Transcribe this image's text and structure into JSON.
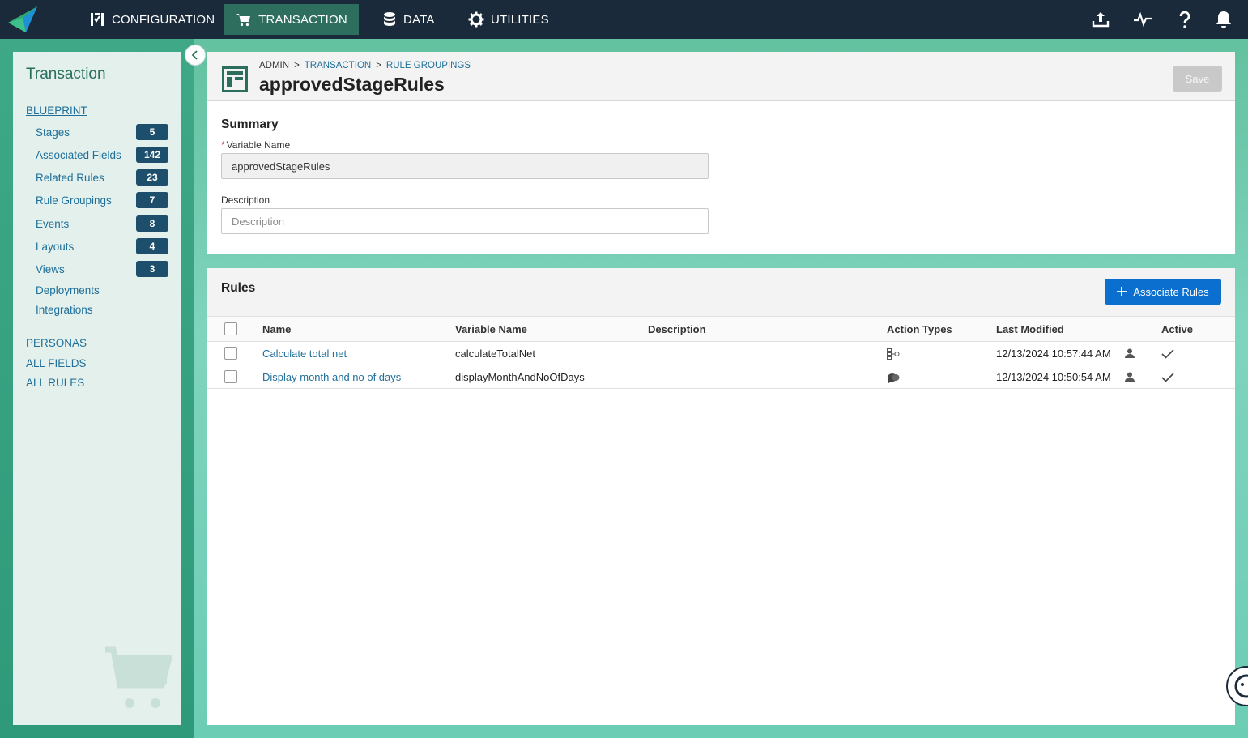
{
  "nav": {
    "items": [
      {
        "label": "CONFIGURATION",
        "icon": "configuration-icon"
      },
      {
        "label": "TRANSACTION",
        "icon": "cart-icon",
        "active": true
      },
      {
        "label": "DATA",
        "icon": "database-icon"
      },
      {
        "label": "UTILITIES",
        "icon": "gear-icon"
      }
    ],
    "right_icons": [
      "upload-icon",
      "activity-icon",
      "help-icon",
      "bell-icon"
    ]
  },
  "sidebar": {
    "title": "Transaction",
    "blueprint": "BLUEPRINT",
    "items": [
      {
        "label": "Stages",
        "count": "5"
      },
      {
        "label": "Associated Fields",
        "count": "142"
      },
      {
        "label": "Related Rules",
        "count": "23"
      },
      {
        "label": "Rule Groupings",
        "count": "7"
      },
      {
        "label": "Events",
        "count": "8"
      },
      {
        "label": "Layouts",
        "count": "4"
      },
      {
        "label": "Views",
        "count": "3"
      },
      {
        "label": "Deployments"
      },
      {
        "label": "Integrations"
      }
    ],
    "links": [
      "PERSONAS",
      "ALL FIELDS",
      "ALL RULES"
    ]
  },
  "header": {
    "breadcrumb": [
      "ADMIN",
      "TRANSACTION",
      "RULE GROUPINGS"
    ],
    "breadcrumb_sep": ">",
    "title": "approvedStageRules",
    "save_label": "Save"
  },
  "summary": {
    "title": "Summary",
    "required_mark": "*",
    "variable_name_label": "Variable Name",
    "variable_name_value": "approvedStageRules",
    "description_label": "Description",
    "description_placeholder": "Description"
  },
  "rules": {
    "title": "Rules",
    "associate_label": "Associate Rules",
    "columns": [
      "Name",
      "Variable Name",
      "Description",
      "Action Types",
      "Last Modified",
      "Active"
    ],
    "rows": [
      {
        "name": "Calculate total net",
        "variable": "calculateTotalNet",
        "description": "",
        "action_icon": "flow-icon",
        "modified": "12/13/2024 10:57:44 AM",
        "active": true
      },
      {
        "name": "Display month and no of days",
        "variable": "displayMonthAndNoOfDays",
        "description": "",
        "action_icon": "message-icon",
        "modified": "12/13/2024 10:50:54 AM",
        "active": true
      }
    ]
  },
  "colors": {
    "nav_bg": "#1a2a3a",
    "nav_active": "#2d6e5e",
    "link": "#1f6f9a",
    "badge": "#1d4e6b",
    "primary_button": "#0b6fcf"
  }
}
